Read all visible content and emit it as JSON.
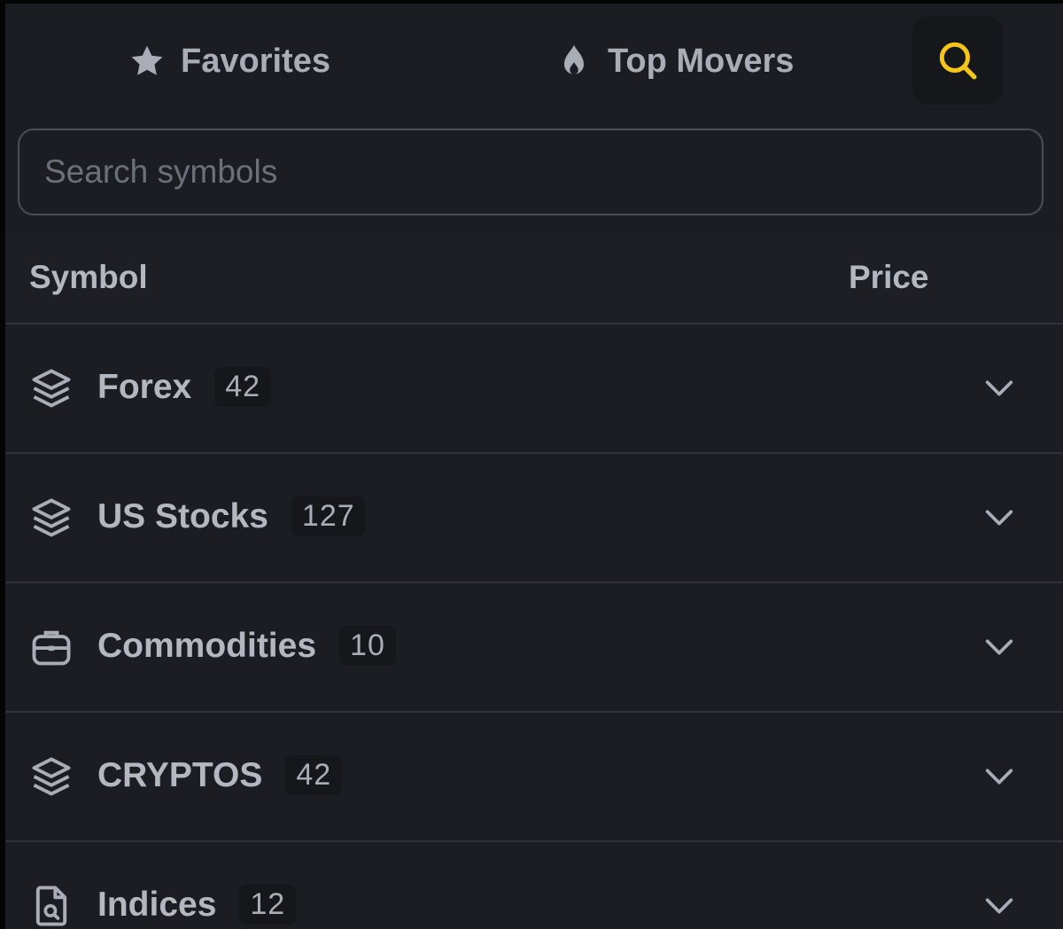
{
  "tabs": {
    "favorites_label": "Favorites",
    "top_movers_label": "Top Movers"
  },
  "search": {
    "placeholder": "Search symbols",
    "value": ""
  },
  "table_header": {
    "symbol": "Symbol",
    "price": "Price"
  },
  "groups": [
    {
      "name": "Forex",
      "count": "42",
      "icon": "layers-icon"
    },
    {
      "name": "US Stocks",
      "count": "127",
      "icon": "layers-icon"
    },
    {
      "name": "Commodities",
      "count": "10",
      "icon": "briefcase-icon"
    },
    {
      "name": "CRYPTOS",
      "count": "42",
      "icon": "layers-icon"
    },
    {
      "name": "Indices",
      "count": "12",
      "icon": "file-search-icon"
    }
  ],
  "colors": {
    "background": "#1b1d23",
    "text": "#b3b7bf",
    "accent": "#f5c518",
    "divider": "#2f323a"
  }
}
